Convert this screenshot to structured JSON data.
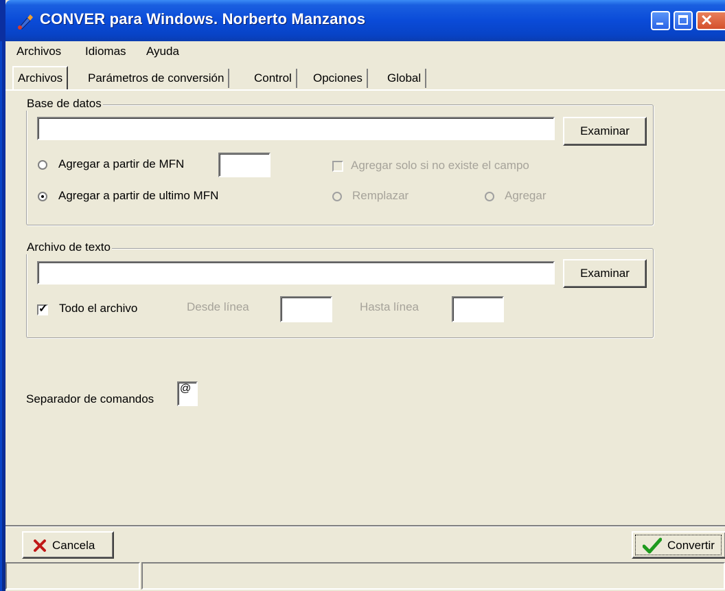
{
  "window": {
    "title": "CONVER para Windows. Norberto Manzanos"
  },
  "menu": [
    "Archivos",
    "Idiomas",
    "Ayuda"
  ],
  "tabs": [
    "Archivos",
    "Parámetros de conversión",
    "Control",
    "Opciones",
    "Global"
  ],
  "base_datos": {
    "legend": "Base de datos",
    "path_value": "",
    "examinar_label": "Examinar",
    "radio_mfn_label": "Agregar a partir de MFN",
    "mfn_value": "",
    "radio_ultimo_label": "Agregar a partir de ultimo MFN",
    "checkbox_solo_label": "Agregar solo si no existe el campo",
    "radio_remplazar_label": "Remplazar",
    "radio_agregar_label": "Agregar"
  },
  "archivo_texto": {
    "legend": "Archivo de texto",
    "path_value": "",
    "examinar_label": "Examinar",
    "todo_label": "Todo el archivo",
    "todo_checked": true,
    "desde_label": "Desde línea",
    "desde_value": "",
    "hasta_label": "Hasta línea",
    "hasta_value": ""
  },
  "separador": {
    "label": "Separador de comandos",
    "value": "@"
  },
  "buttons": {
    "cancela_label": "Cancela",
    "convertir_label": "Convertir"
  },
  "colors": {
    "face": "#ECE9D8",
    "titlebar": "#0A4BD8",
    "disabled_text": "#A6A39A"
  }
}
